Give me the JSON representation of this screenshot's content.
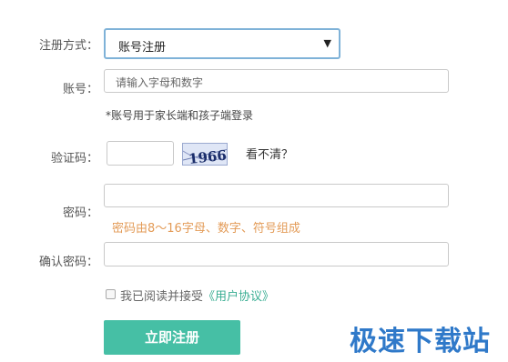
{
  "form": {
    "method_label": "注册方式：",
    "method_value": "账号注册",
    "account_label": "账号：",
    "account_placeholder": "请输入字母和数字",
    "account_hint": "*账号用于家长端和孩子端登录",
    "captcha_label": "验证码：",
    "captcha_image_text": "1966",
    "captcha_refresh": "看不清？",
    "password_label": "密码：",
    "password_rule": "密码由8～16字母、数字、符号组成",
    "confirm_label": "确认密码：",
    "agree_text": "我已阅读并接受",
    "agreement_link": "《用户协议》",
    "submit_label": "立即注册"
  },
  "watermark": "极速下载站",
  "colors": {
    "accent": "#46bfa5",
    "warning": "#e39b57",
    "select_border": "#7fb2d8",
    "watermark": "#2f79c9"
  }
}
